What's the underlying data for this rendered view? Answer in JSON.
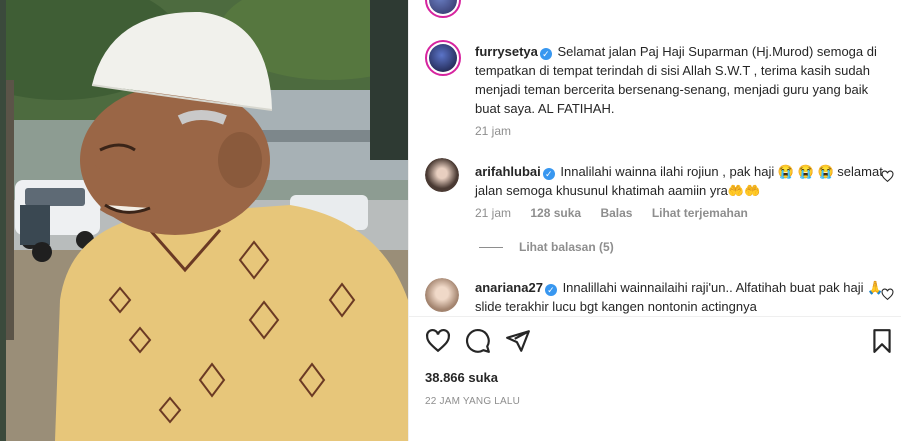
{
  "post": {
    "image_alt": "elderly man in white cap and yellow batik shirt",
    "likes": "38.866 suka",
    "posted_time": "22 JAM YANG LALU"
  },
  "comments": [
    {
      "username": "furrysetya",
      "verified": true,
      "text": "Selamat jalan Paj Haji Suparman (Hj.Murod) semoga di tempatkan di tempat terindah di sisi Allah S.W.T , terima kasih sudah menjadi teman bercerita bersenang-senang, menjadi guru yang baik buat saya. AL FATIHAH.",
      "time": "21 jam"
    },
    {
      "username": "arifahlubai",
      "verified": true,
      "text": "Innalilahi wainna ilahi rojiun , pak haji 😭 😭 😭 selamat jalan semoga khusunul khatimah aamiin yra🤲🤲",
      "time": "21 jam",
      "likes": "128 suka",
      "reply": "Balas",
      "translate": "Lihat terjemahan",
      "view_replies": "Lihat balasan (5)"
    },
    {
      "username": "anariana27",
      "verified": true,
      "text": "Innalillahi wainnailaihi raji'un.. Alfatihah buat pak haji 🙏 slide terakhir lucu bgt kangen nontonin actingnya"
    }
  ],
  "icons": {
    "like": "heart-icon",
    "comment": "comment-icon",
    "share": "share-icon",
    "save": "bookmark-icon"
  },
  "colors": {
    "verified": "#3897f0",
    "muted": "#8e8e8e",
    "text": "#262626"
  }
}
